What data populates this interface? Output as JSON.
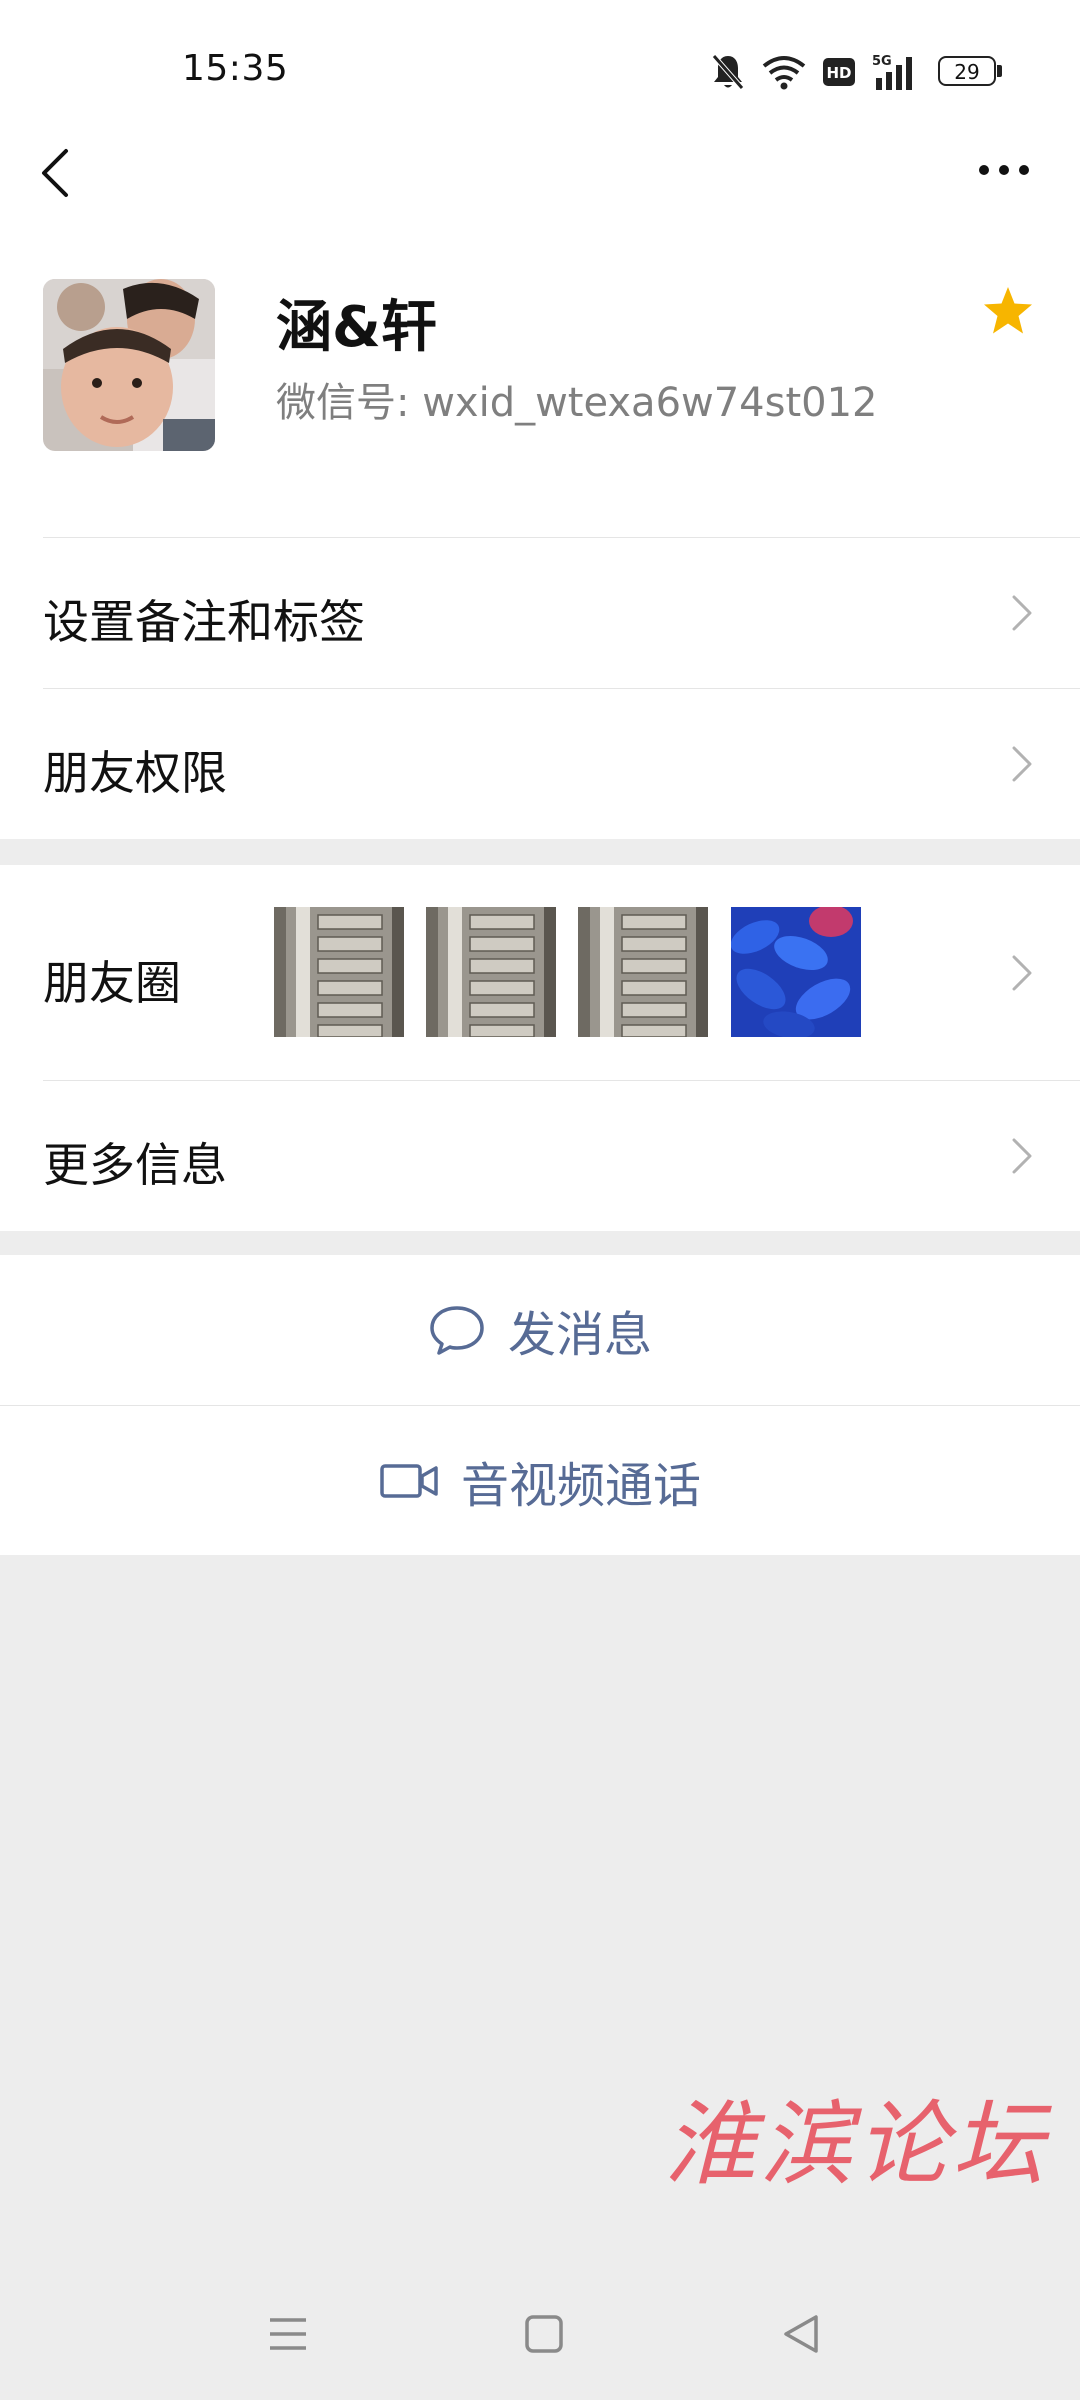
{
  "status_bar": {
    "time": "15:35",
    "battery": "29",
    "icons": [
      "bell-muted-icon",
      "wifi-icon",
      "hd-icon",
      "5g-signal-icon",
      "battery-icon"
    ]
  },
  "header": {
    "back_icon": "chevron-left-icon",
    "more_icon": "more-dots-icon"
  },
  "profile": {
    "name": "涵&轩",
    "wxid": "微信号: wxid_wtexa6w74st012",
    "starred": true,
    "star_color": "#f7b500"
  },
  "menu": {
    "remark": "设置备注和标签",
    "permissions": "朋友权限",
    "moments": "朋友圈",
    "more_info": "更多信息"
  },
  "actions": {
    "message": "发消息",
    "call": "音视频通话"
  },
  "watermark": "淮滨论坛",
  "colors": {
    "link_blue": "#576b95",
    "background": "#ededed",
    "watermark_red": "#e64a57"
  },
  "navbar": {
    "icons": [
      "menu-icon",
      "home-square-icon",
      "back-triangle-icon"
    ]
  }
}
